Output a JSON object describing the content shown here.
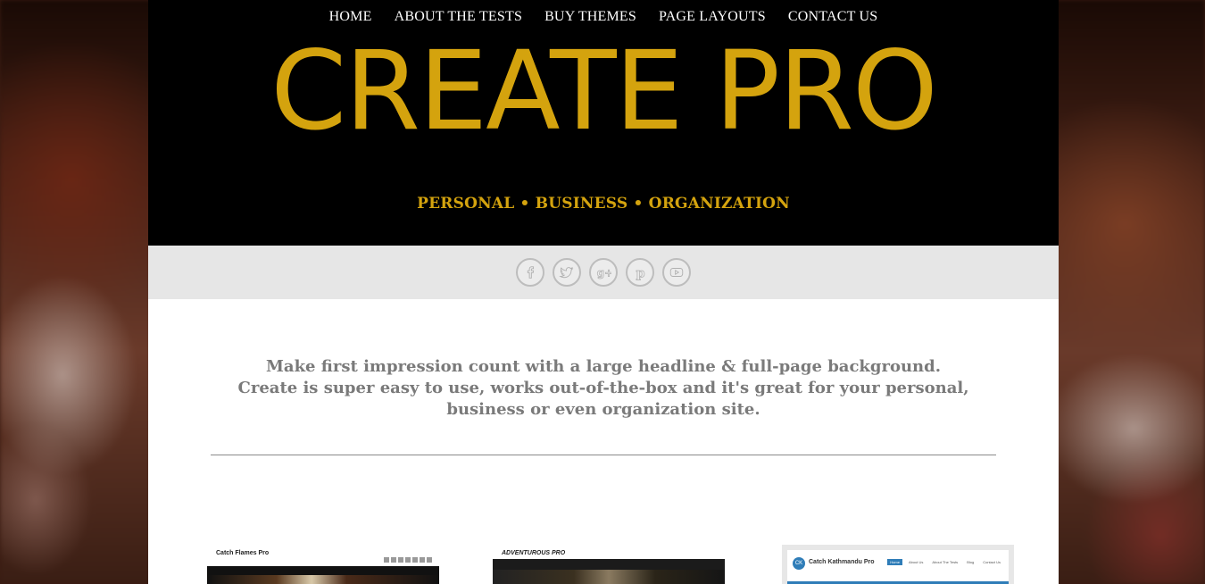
{
  "nav": {
    "items": [
      {
        "label": "HOME"
      },
      {
        "label": "ABOUT THE TESTS"
      },
      {
        "label": "BUY THEMES"
      },
      {
        "label": "PAGE LAYOUTS"
      },
      {
        "label": "CONTACT US"
      }
    ]
  },
  "header": {
    "site_title": "CREATE PRO",
    "tagline": "PERSONAL • BUSINESS • ORGANIZATION",
    "title_color": "#d4a30e",
    "background": "#000000"
  },
  "social": {
    "icons": [
      "facebook-icon",
      "twitter-icon",
      "google-plus-icon",
      "pinterest-icon",
      "youtube-icon"
    ]
  },
  "intro": {
    "line1": "Make first impression count with a large headline & full-page background.",
    "line2": "Create is super easy to use, works out-of-the-box and it's great for your personal, business or even organization site."
  },
  "thumbnails": [
    {
      "title": "Catch Flames Pro"
    },
    {
      "title": "ADVENTUROUS PRO"
    },
    {
      "title": "Catch Kathmandu Pro",
      "menu": [
        "Home",
        "About Us",
        "About The Tests",
        "Blog",
        "Contact Us"
      ]
    }
  ]
}
